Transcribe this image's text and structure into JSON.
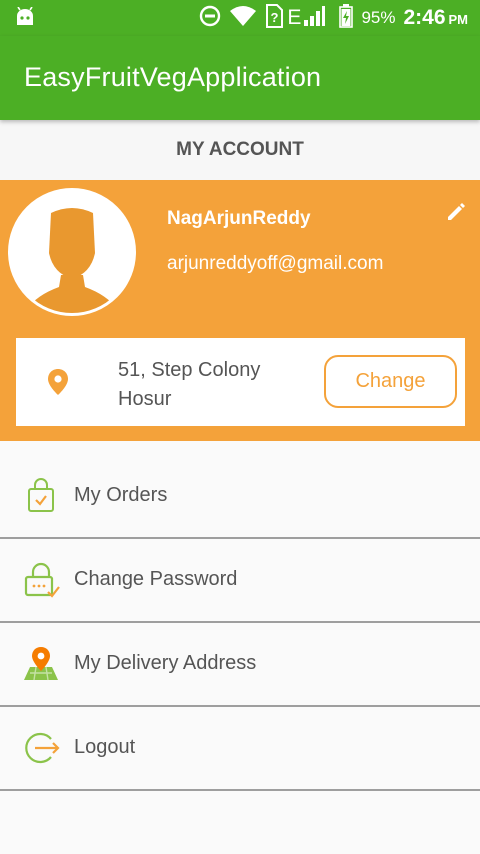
{
  "status_bar": {
    "battery_percent": "95%",
    "time": "2:46",
    "time_suffix": "PM",
    "network_label": "E",
    "icons": [
      "android-icon",
      "do-not-disturb-icon",
      "wifi-icon",
      "sim-icon",
      "signal-icon",
      "battery-icon"
    ]
  },
  "app_bar": {
    "title": "EasyFruitVegApplication"
  },
  "section_title": "MY ACCOUNT",
  "profile": {
    "name": "NagArjunReddy",
    "email": "arjunreddyoff@gmail.com",
    "avatar_icon": "user-silhouette-icon",
    "edit_icon": "pencil-icon"
  },
  "address": {
    "line1": "51, Step Colony",
    "line2": "Hosur",
    "change_label": "Change",
    "icon": "location-pin-icon"
  },
  "menu": {
    "items": [
      {
        "label": "My Orders",
        "icon": "shopping-bag-icon"
      },
      {
        "label": "Change Password",
        "icon": "lock-icon"
      },
      {
        "label": "My Delivery Address",
        "icon": "map-pin-icon"
      },
      {
        "label": "Logout",
        "icon": "logout-icon"
      }
    ]
  },
  "colors": {
    "primary_green": "#4caf25",
    "accent_orange": "#f4a23a",
    "text_gray": "#555555"
  }
}
